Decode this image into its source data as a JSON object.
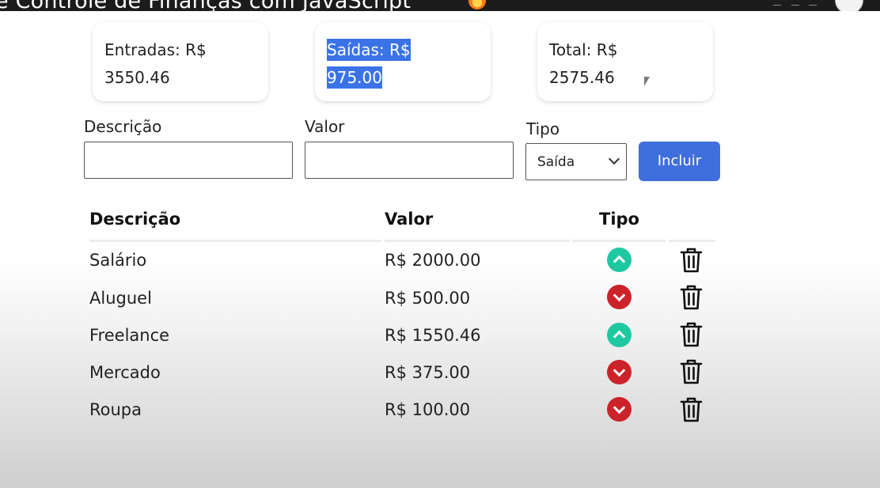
{
  "video": {
    "title": "e Controle de Finanças com JavaScript"
  },
  "summary": {
    "entradas": {
      "label": "Entradas: R$",
      "value": "3550.46"
    },
    "saidas": {
      "label": "Saídas: R$",
      "value": "975.00"
    },
    "total": {
      "label": "Total: R$",
      "value": "2575.46"
    }
  },
  "form": {
    "descricao_label": "Descrição",
    "descricao_value": "",
    "valor_label": "Valor",
    "valor_value": "",
    "tipo_label": "Tipo",
    "tipo_selected": "Saída",
    "submit_label": "Incluir"
  },
  "table": {
    "headers": {
      "descricao": "Descrição",
      "valor": "Valor",
      "tipo": "Tipo"
    },
    "rows": [
      {
        "descricao": "Salário",
        "valor": "R$ 2000.00",
        "tipo": "entrada",
        "icon": "chevron-up-circle-icon"
      },
      {
        "descricao": "Aluguel",
        "valor": "R$ 500.00",
        "tipo": "saida",
        "icon": "chevron-down-circle-icon"
      },
      {
        "descricao": "Freelance",
        "valor": "R$ 1550.46",
        "tipo": "entrada",
        "icon": "chevron-up-circle-icon"
      },
      {
        "descricao": "Mercado",
        "valor": "R$ 375.00",
        "tipo": "saida",
        "icon": "chevron-down-circle-icon"
      },
      {
        "descricao": "Roupa",
        "valor": "R$ 100.00",
        "tipo": "saida",
        "icon": "chevron-down-circle-icon"
      }
    ]
  },
  "colors": {
    "entrada": "#1ec8a0",
    "saida": "#cc2229",
    "accent": "#3f6fdc",
    "selection": "#3b73e6"
  }
}
